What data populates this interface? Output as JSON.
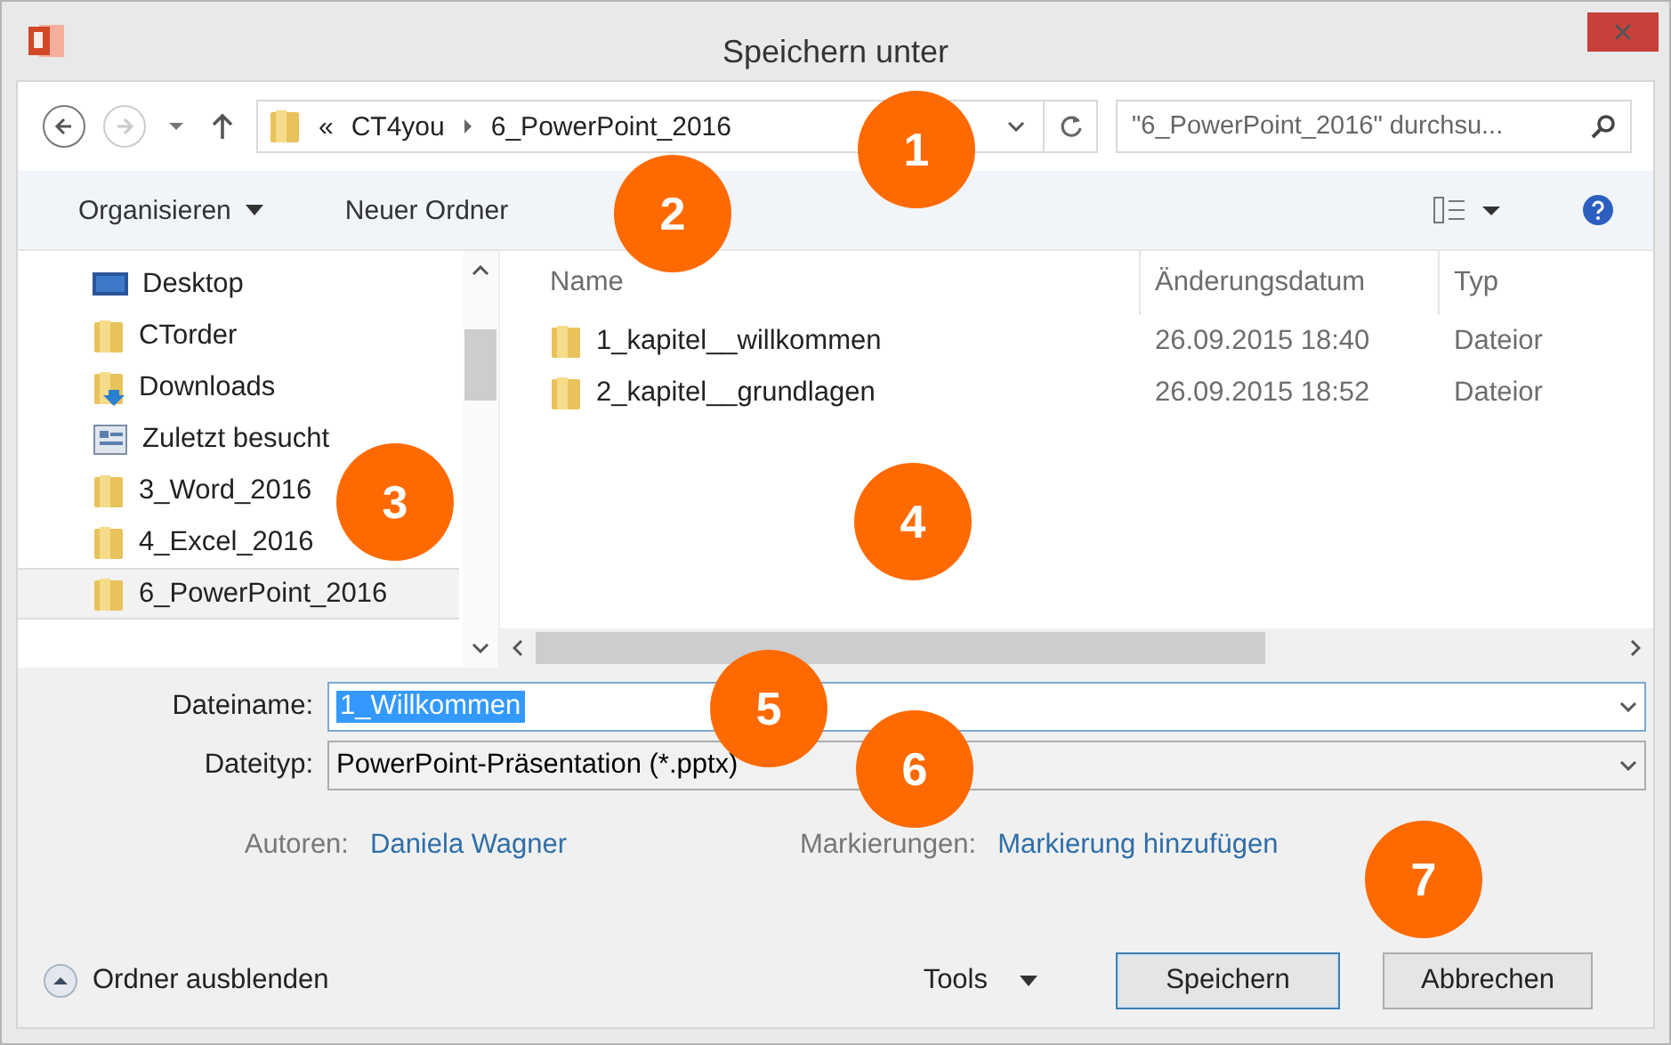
{
  "window": {
    "title": "Speichern unter"
  },
  "address": {
    "prefix": "«",
    "path": [
      "CT4you",
      "6_PowerPoint_2016"
    ]
  },
  "search": {
    "placeholder": "\"6_PowerPoint_2016\" durchsu..."
  },
  "toolbar": {
    "organize": "Organisieren",
    "new_folder": "Neuer Ordner"
  },
  "sidebar": {
    "items": [
      {
        "label": "Desktop",
        "kind": "desktop",
        "selected": false
      },
      {
        "label": "CTorder",
        "kind": "folder",
        "selected": false
      },
      {
        "label": "Downloads",
        "kind": "downloads",
        "selected": false
      },
      {
        "label": "Zuletzt besucht",
        "kind": "recent",
        "selected": false
      },
      {
        "label": "3_Word_2016",
        "kind": "folder",
        "selected": false
      },
      {
        "label": "4_Excel_2016",
        "kind": "folder",
        "selected": false
      },
      {
        "label": "6_PowerPoint_2016",
        "kind": "folder",
        "selected": true
      }
    ]
  },
  "table": {
    "columns": [
      "Name",
      "Änderungsdatum",
      "Typ"
    ],
    "rows": [
      {
        "name": "1_kapitel__willkommen",
        "date": "26.09.2015 18:40",
        "type": "Dateior"
      },
      {
        "name": "2_kapitel__grundlagen",
        "date": "26.09.2015 18:52",
        "type": "Dateior"
      }
    ]
  },
  "form": {
    "filename_label": "Dateiname:",
    "filename": "1_Willkommen",
    "filetype_label": "Dateityp:",
    "filetype": "PowerPoint-Präsentation (*.pptx)",
    "authors_label": "Autoren:",
    "authors": "Daniela Wagner",
    "tags_label": "Markierungen:",
    "tags": "Markierung hinzufügen"
  },
  "footer": {
    "hide_folders": "Ordner ausblenden",
    "tools": "Tools",
    "save": "Speichern",
    "cancel": "Abbrechen"
  },
  "callouts": [
    "1",
    "2",
    "3",
    "4",
    "5",
    "6",
    "7"
  ]
}
